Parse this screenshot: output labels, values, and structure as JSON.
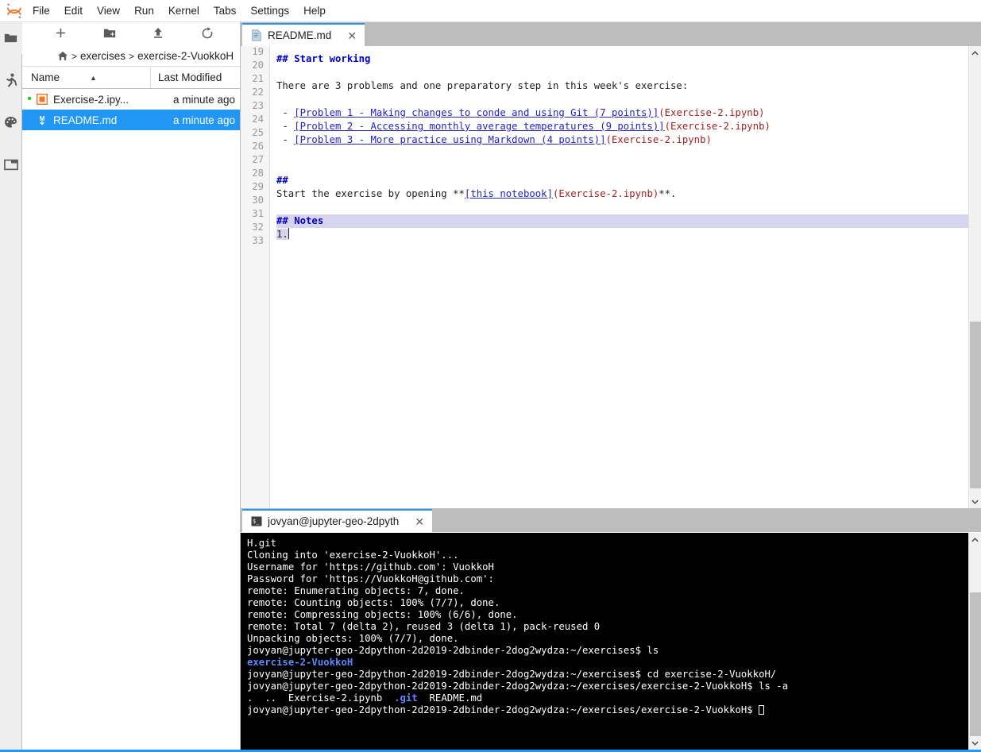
{
  "menubar": {
    "logo_name": "jupyter-logo",
    "items": [
      "File",
      "Edit",
      "View",
      "Run",
      "Kernel",
      "Tabs",
      "Settings",
      "Help"
    ]
  },
  "activitybar": {
    "items": [
      {
        "name": "file-browser-icon",
        "glyph": "folder"
      },
      {
        "name": "running-terminals-icon",
        "glyph": "runner"
      },
      {
        "name": "commands-palette-icon",
        "glyph": "palette"
      },
      {
        "name": "open-tabs-icon",
        "glyph": "window"
      }
    ]
  },
  "filebrowser": {
    "toolbar": [
      {
        "name": "new-launcher-button",
        "glyph": "plus",
        "title": "New Launcher"
      },
      {
        "name": "new-folder-button",
        "glyph": "new-folder",
        "title": "New Folder"
      },
      {
        "name": "upload-button",
        "glyph": "upload",
        "title": "Upload"
      },
      {
        "name": "refresh-button",
        "glyph": "refresh",
        "title": "Refresh File List"
      }
    ],
    "breadcrumb": {
      "home": "home-icon",
      "crumbs": [
        "exercises",
        "exercise-2-VuokkoH"
      ],
      "separator": ">"
    },
    "columns": {
      "name": "Name",
      "last_modified": "Last Modified",
      "sort_indicator": "▲"
    },
    "rows": [
      {
        "name": "Exercise-2.ipy...",
        "modified": "a minute ago",
        "icon": "notebook-icon",
        "running": true,
        "selected": false
      },
      {
        "name": "README.md",
        "modified": "a minute ago",
        "icon": "markdown-icon",
        "running": false,
        "selected": true
      }
    ]
  },
  "editor": {
    "tab": {
      "label": "README.md",
      "icon": "markdown-file-icon",
      "close": "✕"
    },
    "first_partial_line": "18",
    "lines": [
      {
        "n": "19",
        "segments": [
          {
            "t": "## Start working",
            "c": "head"
          }
        ]
      },
      {
        "n": "20",
        "segments": []
      },
      {
        "n": "21",
        "segments": [
          {
            "t": "There are 3 problems and one preparatory step in this week's exercise:",
            "c": "plain"
          }
        ]
      },
      {
        "n": "22",
        "segments": []
      },
      {
        "n": "23",
        "segments": [
          {
            "t": " - ",
            "c": "plain"
          },
          {
            "t": "[Problem 1 - Making changes to conde and using Git (7 points)]",
            "c": "link"
          },
          {
            "t": "(Exercise-2.ipynb)",
            "c": "url"
          }
        ]
      },
      {
        "n": "24",
        "segments": [
          {
            "t": " - ",
            "c": "plain"
          },
          {
            "t": "[Problem 2 - Accessing monthly average temperatures (9 points)]",
            "c": "link"
          },
          {
            "t": "(Exercise-2.ipynb)",
            "c": "url"
          }
        ]
      },
      {
        "n": "25",
        "segments": [
          {
            "t": " - ",
            "c": "plain"
          },
          {
            "t": "[Problem 3 - More practice using Markdown (4 points)]",
            "c": "link"
          },
          {
            "t": "(Exercise-2.ipynb)",
            "c": "url"
          }
        ]
      },
      {
        "n": "26",
        "segments": []
      },
      {
        "n": "27",
        "segments": []
      },
      {
        "n": "28",
        "segments": [
          {
            "t": "##",
            "c": "head"
          }
        ]
      },
      {
        "n": "29",
        "segments": [
          {
            "t": "Start the exercise by opening **",
            "c": "plain"
          },
          {
            "t": "[this notebook]",
            "c": "link"
          },
          {
            "t": "(Exercise-2.ipynb)",
            "c": "url"
          },
          {
            "t": "**.",
            "c": "plain"
          }
        ]
      },
      {
        "n": "30",
        "segments": []
      },
      {
        "n": "31",
        "segments": [
          {
            "t": "## Notes",
            "c": "head"
          }
        ],
        "highlight": "full"
      },
      {
        "n": "32",
        "segments": [
          {
            "t": "1.",
            "c": "plain"
          }
        ],
        "highlight": "partial",
        "cursor": true
      },
      {
        "n": "33",
        "segments": []
      }
    ],
    "scrollbar": {
      "up": "⌃",
      "down": "⌄"
    }
  },
  "terminal": {
    "tab": {
      "label": "jovyan@jupyter-geo-2dpyth",
      "icon": "terminal-icon",
      "close": "✕"
    },
    "lines": [
      [
        {
          "t": "H.git",
          "c": "white"
        }
      ],
      [
        {
          "t": "Cloning into 'exercise-2-VuokkoH'...",
          "c": "white"
        }
      ],
      [
        {
          "t": "Username for 'https://github.com': VuokkoH",
          "c": "white"
        }
      ],
      [
        {
          "t": "Password for 'https://VuokkoH@github.com':",
          "c": "white"
        }
      ],
      [
        {
          "t": "remote: Enumerating objects: 7, done.",
          "c": "white"
        }
      ],
      [
        {
          "t": "remote: Counting objects: 100% (7/7), done.",
          "c": "white"
        }
      ],
      [
        {
          "t": "remote: Compressing objects: 100% (6/6), done.",
          "c": "white"
        }
      ],
      [
        {
          "t": "remote: Total 7 (delta 2), reused 3 (delta 1), pack-reused 0",
          "c": "white"
        }
      ],
      [
        {
          "t": "Unpacking objects: 100% (7/7), done.",
          "c": "white"
        }
      ],
      [
        {
          "t": "jovyan@jupyter-geo-2dpython-2d2019-2dbinder-2dog2wydza:~/exercises$ ls",
          "c": "white"
        }
      ],
      [
        {
          "t": "exercise-2-VuokkoH",
          "c": "blue"
        }
      ],
      [
        {
          "t": "jovyan@jupyter-geo-2dpython-2d2019-2dbinder-2dog2wydza:~/exercises$ cd exercise-2-VuokkoH/",
          "c": "white"
        }
      ],
      [
        {
          "t": "jovyan@jupyter-geo-2dpython-2d2019-2dbinder-2dog2wydza:~/exercises/exercise-2-VuokkoH$ ls -a",
          "c": "white"
        }
      ],
      [
        {
          "t": ".  ..  Exercise-2.ipynb  ",
          "c": "white"
        },
        {
          "t": ".git",
          "c": "blue"
        },
        {
          "t": "  README.md",
          "c": "white"
        }
      ],
      [
        {
          "t": "jovyan@jupyter-geo-2dpython-2d2019-2dbinder-2dog2wydza:~/exercises/exercise-2-VuokkoH$ ",
          "c": "white",
          "cursor": true
        }
      ]
    ],
    "scrollbar": {
      "up": "⌃",
      "down": "⌄"
    }
  },
  "colors": {
    "accent_blue": "#2196f3",
    "selection_lavender": "#d7d4f0",
    "heading_blue": "#0000cc",
    "link_blue": "#2222cc",
    "url_maroon": "#a52020",
    "terminal_bg": "#000000",
    "terminal_dir_blue": "#5f87ff",
    "running_dot_green": "#21c521",
    "chrome_gray": "#bdbdbd"
  }
}
